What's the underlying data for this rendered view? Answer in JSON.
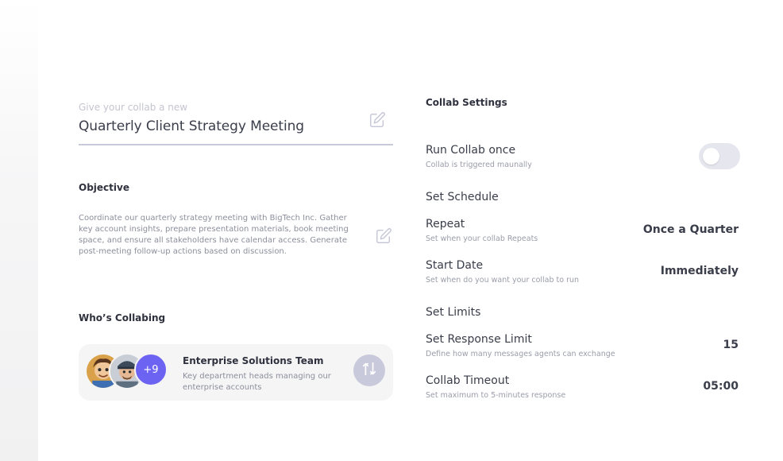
{
  "collab": {
    "name_label": "Give your collab a new",
    "name_value": "Quarterly Client Strategy Meeting"
  },
  "objective": {
    "heading": "Objective",
    "text": "Coordinate our quarterly strategy meeting with BigTech Inc. Gather key account insights, prepare presentation materials, book meeting space, and ensure all stakeholders have calendar access. Generate post-meeting follow-up actions based on discussion."
  },
  "collaborators": {
    "heading": "Who’s Collabing",
    "more_count": "+9",
    "team_name": "Enterprise Solutions Team",
    "team_description": "Key department heads managing our enterprise accounts"
  },
  "settings": {
    "title": "Collab Settings",
    "run_once": {
      "title": "Run Collab once",
      "subtitle": "Collab is triggered maunally",
      "enabled": false
    },
    "schedule": {
      "heading": "Set Schedule",
      "repeat": {
        "title": "Repeat",
        "subtitle": "Set when your collab Repeats",
        "value": "Once a Quarter"
      },
      "start_date": {
        "title": "Start Date",
        "subtitle": "Set when do you want your collab to run",
        "value": "Immediately"
      }
    },
    "limits": {
      "heading": "Set Limits",
      "response_limit": {
        "title": "Set Response Limit",
        "subtitle": "Define how many messages agents can exchange",
        "value": "15"
      },
      "timeout": {
        "title": "Collab Timeout",
        "subtitle": "Set maximum to 5-minutes response",
        "value": "05:00"
      }
    }
  },
  "colors": {
    "accent": "#6d63f2",
    "toggle_off": "#e6e6ee",
    "swap_button": "#c9c9dc"
  },
  "icons": {
    "edit": "edit-icon",
    "swap": "swap-icon"
  }
}
